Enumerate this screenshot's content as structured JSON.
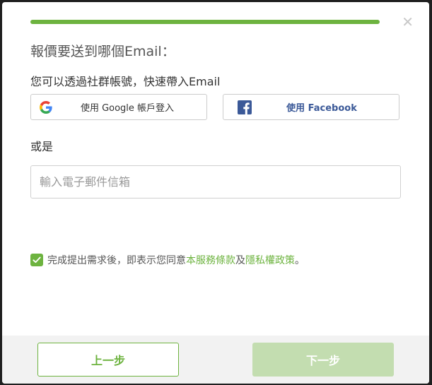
{
  "progress": {
    "fraction": 1.0,
    "color": "#6db33f"
  },
  "close_icon": "close-icon",
  "title": "報價要送到哪個Email：",
  "social_prompt": "您可以透過社群帳號，快速帶入Email",
  "google_button": {
    "label": "使用 Google 帳戶登入",
    "icon": "google-icon"
  },
  "facebook_button": {
    "label": "使用 Facebook",
    "icon": "facebook-icon"
  },
  "or_label": "或是",
  "email_input": {
    "placeholder": "輸入電子郵件信箱",
    "value": ""
  },
  "consent": {
    "checked": true,
    "prefix": "完成提出需求後，即表示您同意",
    "terms_link": "本服務條款",
    "conjunction": "及",
    "privacy_link": "隱私權政策",
    "suffix": "。"
  },
  "footer": {
    "prev_label": "上一步",
    "next_label": "下一步"
  },
  "colors": {
    "accent": "#6db33f",
    "disabled_accent": "#c3ddb0",
    "facebook": "#3b5998"
  }
}
